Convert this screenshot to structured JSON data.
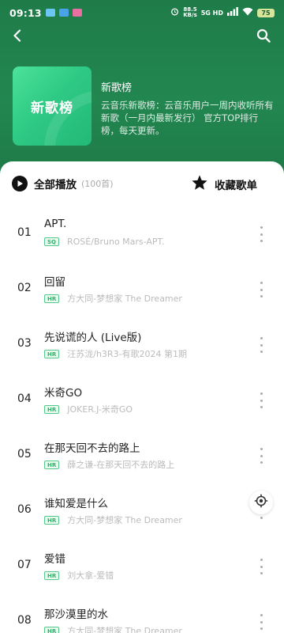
{
  "status_bar": {
    "time": "09:13",
    "network_speed_value": "88.5",
    "network_speed_unit": "KB/s",
    "signal_text": "5G HD",
    "battery": "75"
  },
  "icons": {
    "back": "chevron-left-icon",
    "search": "search-icon",
    "play_all": "play-circle-icon",
    "collect": "star-icon",
    "more": "more-vertical-icon",
    "locate": "locate-icon"
  },
  "colors": {
    "header_bg": "#1f7c49",
    "cover_bg": "#2fca85",
    "badge_green": "#2fb36b"
  },
  "playlist": {
    "cover_text": "新歌榜",
    "name": "新歌榜",
    "description": "云音乐新歌榜：云音乐用户一周内收听所有新歌（一月内最新发行） 官方TOP排行榜，每天更新。"
  },
  "actions": {
    "play_all_label": "全部播放",
    "play_all_count": "(100首)",
    "collect_label": "收藏歌单"
  },
  "tracks": [
    {
      "no": "01",
      "title": "APT.",
      "badge": "SQ",
      "artist": "ROSÉ/Bruno Mars-APT."
    },
    {
      "no": "02",
      "title": "回留",
      "badge": "HR",
      "artist": "方大同-梦想家 The Dreamer"
    },
    {
      "no": "03",
      "title": "先说谎的人 (Live版)",
      "badge": "HR",
      "artist": "汪苏泷/h3R3-有歌2024 第1期"
    },
    {
      "no": "04",
      "title": "米奇GO",
      "badge": "HR",
      "artist": "JOKER.J-米奇GO"
    },
    {
      "no": "05",
      "title": "在那天回不去的路上",
      "badge": "HR",
      "artist": "薛之谦-在那天回不去的路上"
    },
    {
      "no": "06",
      "title": "谁知爱是什么",
      "badge": "HR",
      "artist": "方大同-梦想家 The Dreamer"
    },
    {
      "no": "07",
      "title": "爱错",
      "badge": "HR",
      "artist": "刘大拿-爱错"
    },
    {
      "no": "08",
      "title": "那沙漠里的水",
      "badge": "HR",
      "artist": "方大同-梦想家 The Dreamer"
    }
  ]
}
